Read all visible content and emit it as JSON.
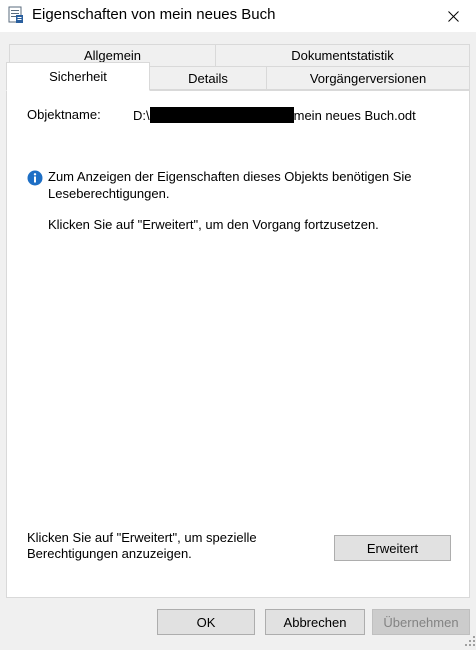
{
  "window": {
    "title": "Eigenschaften von mein neues Buch",
    "icon": "document-properties-icon",
    "close_icon": "close-icon"
  },
  "tabs": {
    "row1": [
      {
        "label": "Allgemein"
      },
      {
        "label": "Dokumentstatistik"
      }
    ],
    "row2": [
      {
        "label": "Sicherheit",
        "active": true
      },
      {
        "label": "Details"
      },
      {
        "label": "Vorgängerversionen"
      }
    ]
  },
  "security": {
    "object_name_label": "Objektname:",
    "object_name_prefix": "D:\\",
    "object_name_suffix": "mein neues Buch.odt",
    "info_icon": "info-icon",
    "info_text": "Zum Anzeigen der Eigenschaften dieses Objekts benötigen Sie Leseberechtigungen.",
    "hint_text": "Klicken Sie auf \"Erweitert\", um den Vorgang fortzusetzen.",
    "advanced_hint": "Klicken Sie auf \"Erweitert\", um spezielle Berechtigungen anzuzeigen.",
    "advanced_button": "Erweitert"
  },
  "footer": {
    "ok": "OK",
    "cancel": "Abbrechen",
    "apply": "Übernehmen",
    "apply_enabled": false
  },
  "colors": {
    "dialog_background": "#f0f0f0",
    "panel_background": "#ffffff",
    "info_icon_blue": "#1e6fc5",
    "button_face": "#e1e1e1",
    "disabled_text": "#838383"
  }
}
